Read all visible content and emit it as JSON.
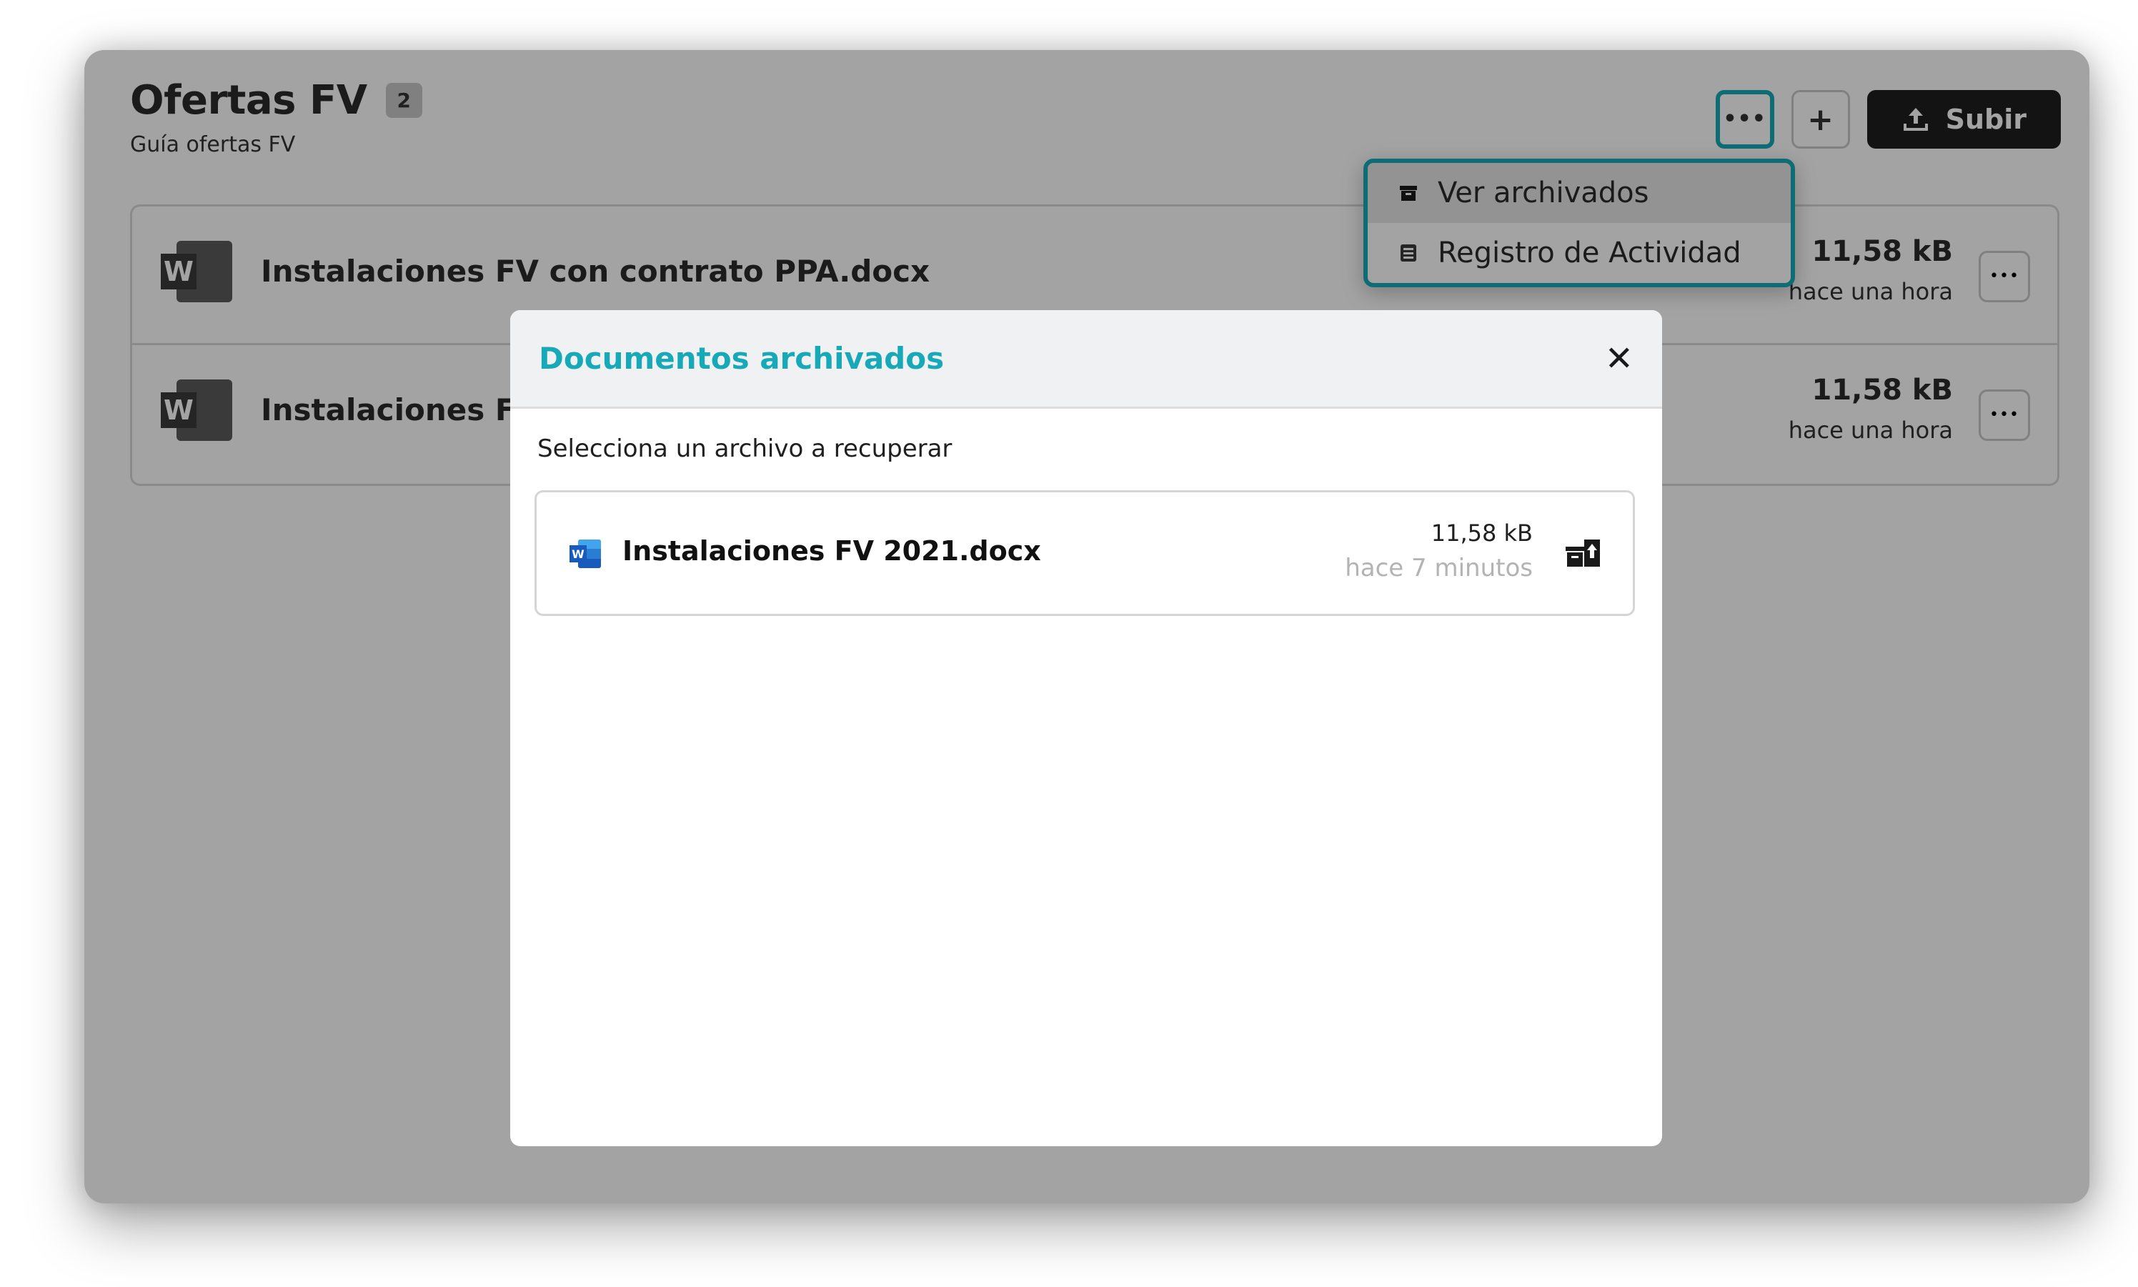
{
  "header": {
    "title": "Ofertas FV",
    "count": "2",
    "subtitle": "Guía ofertas FV"
  },
  "toolbar": {
    "more_icon": "more-dots-icon",
    "add_icon": "plus-icon",
    "upload_label": "Subir",
    "upload_icon": "upload-icon"
  },
  "files": [
    {
      "name": "Instalaciones FV con contrato PPA.docx",
      "size": "11,58 kB",
      "date": "hace una hora"
    },
    {
      "name": "Instalaciones FV",
      "size": "11,58 kB",
      "date": "hace una hora"
    }
  ],
  "dropdown": {
    "items": [
      {
        "label": "Ver archivados",
        "icon": "archive-box-icon"
      },
      {
        "label": "Registro de Actividad",
        "icon": "activity-log-icon"
      }
    ]
  },
  "modal": {
    "title": "Documentos archivados",
    "instruction": "Selecciona un archivo a recuperar",
    "archived": [
      {
        "name": "Instalaciones FV 2021.docx",
        "size": "11,58 kB",
        "date": "hace 7 minutos"
      }
    ]
  },
  "colors": {
    "accent": "#17a9b8",
    "dark_button": "#1f1f1f",
    "overlay": "rgba(0,0,0,0.36)"
  }
}
